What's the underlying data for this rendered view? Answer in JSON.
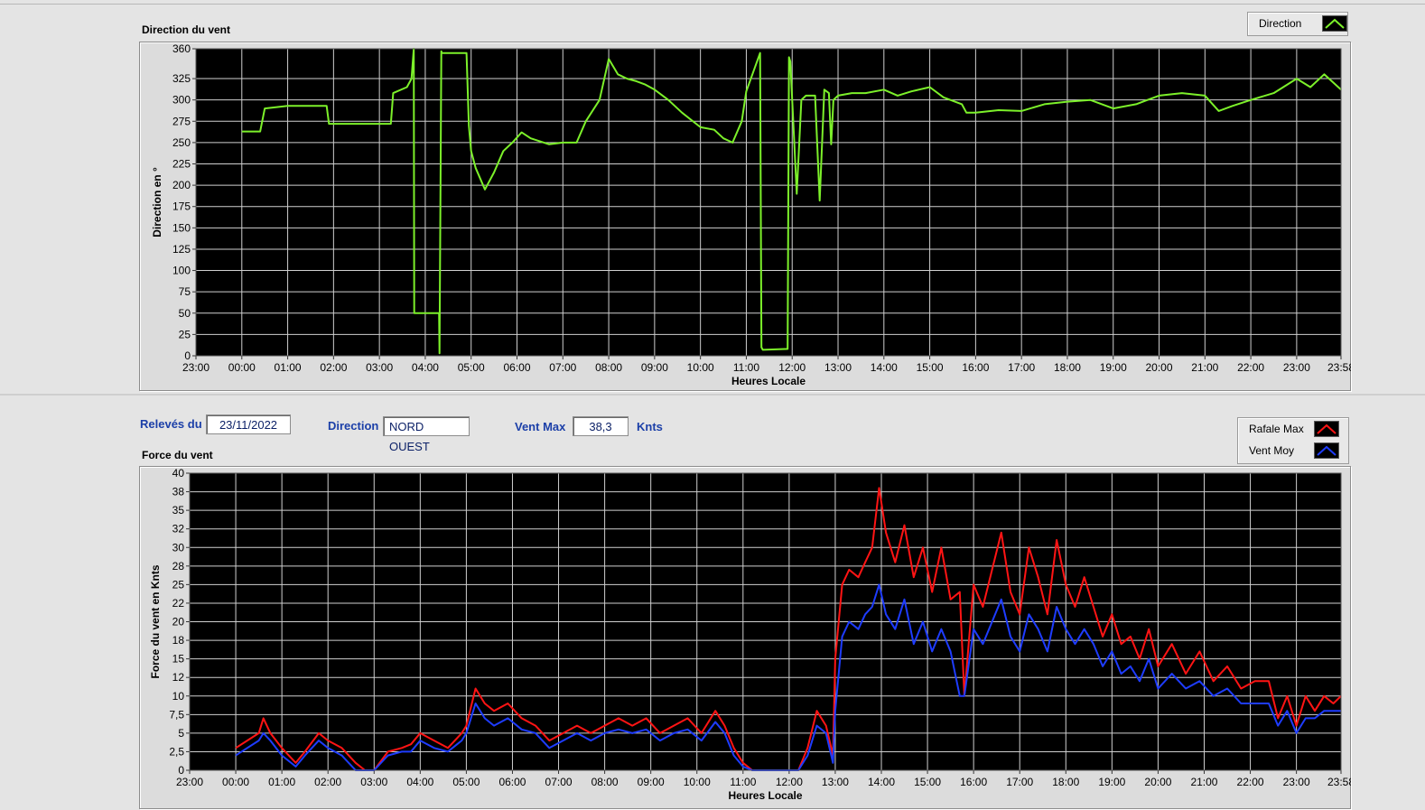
{
  "direction_panel": {
    "title": "Direction du vent"
  },
  "force_panel": {
    "title": "Force du vent"
  },
  "info": {
    "releves_label": "Relevés du",
    "releves_value": "23/11/2022",
    "direction_label": "Direction",
    "direction_value": "NORD OUEST",
    "ventmax_label": "Vent Max",
    "ventmax_value": "38,3",
    "ventmax_unit": "Knts"
  },
  "legend_direction": [
    {
      "label": "Direction",
      "color": "#7cf02a"
    }
  ],
  "legend_force": [
    {
      "label": "Rafale Max",
      "color": "#ff1414"
    },
    {
      "label": "Vent Moy",
      "color": "#1e3cff"
    }
  ],
  "colors": {
    "plot_bg": "#000000",
    "grid": "#cfcfcf",
    "direction": "#7cf02a",
    "rafale": "#ff1414",
    "ventmoy": "#1e3cff"
  },
  "chart_data": [
    {
      "type": "line",
      "xlabel": "Heures Locale",
      "ylabel": "Direction en °",
      "x_tick_labels": [
        "23:00",
        "00:00",
        "01:00",
        "02:00",
        "03:00",
        "04:00",
        "05:00",
        "06:00",
        "07:00",
        "08:00",
        "09:00",
        "10:00",
        "11:00",
        "12:00",
        "13:00",
        "14:00",
        "15:00",
        "16:00",
        "17:00",
        "18:00",
        "19:00",
        "20:00",
        "21:00",
        "22:00",
        "23:00",
        "23:58"
      ],
      "y_tick_labels": [
        "0",
        "25",
        "50",
        "75",
        "100",
        "125",
        "150",
        "175",
        "200",
        "225",
        "250",
        "275",
        "300",
        "325",
        "360"
      ],
      "y_ticks": [
        0,
        25,
        50,
        75,
        100,
        125,
        150,
        175,
        200,
        225,
        250,
        275,
        300,
        325,
        360
      ],
      "ylim": [
        0,
        360
      ],
      "xlim_hours": [
        -1,
        23.967
      ],
      "grid": true,
      "series": [
        {
          "name": "Direction",
          "x_hours": [
            0.0,
            0.4,
            0.5,
            1.0,
            1.6,
            1.85,
            1.9,
            2.5,
            3.0,
            3.25,
            3.3,
            3.6,
            3.7,
            3.75,
            3.76,
            4.0,
            4.3,
            4.31,
            4.35,
            4.36,
            4.5,
            4.9,
            4.95,
            5.0,
            5.1,
            5.3,
            5.5,
            5.7,
            5.9,
            6.1,
            6.3,
            6.7,
            7.0,
            7.3,
            7.5,
            7.8,
            8.0,
            8.2,
            8.4,
            8.6,
            8.8,
            9.0,
            9.3,
            9.6,
            10.0,
            10.3,
            10.5,
            10.7,
            10.9,
            11.0,
            11.3,
            11.33,
            11.36,
            11.9,
            11.93,
            11.96,
            12.1,
            12.2,
            12.3,
            12.5,
            12.6,
            12.7,
            12.8,
            12.85,
            12.9,
            13.0,
            13.3,
            13.6,
            14.0,
            14.3,
            14.6,
            15.0,
            15.3,
            15.7,
            15.8,
            16.0,
            16.5,
            17.0,
            17.5,
            18.0,
            18.5,
            19.0,
            19.5,
            20.0,
            20.5,
            21.0,
            21.3,
            21.6,
            22.0,
            22.5,
            23.0,
            23.3,
            23.6,
            23.967
          ],
          "values": [
            263,
            263,
            290,
            293,
            293,
            293,
            272,
            272,
            272,
            272,
            308,
            315,
            325,
            360,
            50,
            50,
            50,
            3,
            357,
            355,
            355,
            355,
            270,
            240,
            220,
            195,
            215,
            240,
            250,
            262,
            255,
            248,
            250,
            250,
            275,
            300,
            348,
            330,
            325,
            322,
            318,
            312,
            300,
            285,
            268,
            265,
            255,
            250,
            275,
            310,
            355,
            10,
            7,
            8,
            350,
            345,
            190,
            300,
            305,
            305,
            182,
            312,
            308,
            248,
            300,
            305,
            308,
            308,
            312,
            305,
            310,
            315,
            303,
            295,
            285,
            285,
            288,
            287,
            295,
            298,
            300,
            290,
            295,
            305,
            308,
            305,
            287,
            293,
            300,
            308,
            325,
            315,
            330,
            312
          ]
        }
      ]
    },
    {
      "type": "line",
      "xlabel": "Heures Locale",
      "ylabel": "Force du vent en Knts",
      "x_tick_labels": [
        "23:00",
        "00:00",
        "01:00",
        "02:00",
        "03:00",
        "04:00",
        "05:00",
        "06:00",
        "07:00",
        "08:00",
        "09:00",
        "10:00",
        "11:00",
        "12:00",
        "13:00",
        "14:00",
        "15:00",
        "16:00",
        "17:00",
        "18:00",
        "19:00",
        "20:00",
        "21:00",
        "22:00",
        "23:00",
        "23:58"
      ],
      "y_tick_labels": [
        "0",
        "2,5",
        "5",
        "7,5",
        "10",
        "12",
        "15",
        "18",
        "20",
        "22",
        "25",
        "28",
        "30",
        "32",
        "35",
        "38",
        "40"
      ],
      "y_ticks": [
        0,
        2.5,
        5,
        7.5,
        10,
        12.5,
        15,
        17.5,
        20,
        22.5,
        25,
        27.5,
        30,
        32.5,
        35,
        37.5,
        40
      ],
      "ylim": [
        0,
        40
      ],
      "xlim_hours": [
        -1,
        23.967
      ],
      "grid": true,
      "series": [
        {
          "name": "Rafale Max",
          "x_hours": [
            0.0,
            0.25,
            0.5,
            0.6,
            0.75,
            1.0,
            1.3,
            1.5,
            1.8,
            2.0,
            2.3,
            2.6,
            2.8,
            3.0,
            3.3,
            3.6,
            3.8,
            4.0,
            4.3,
            4.6,
            4.9,
            5.0,
            5.2,
            5.4,
            5.6,
            5.9,
            6.2,
            6.5,
            6.8,
            7.1,
            7.4,
            7.7,
            8.0,
            8.3,
            8.6,
            8.9,
            9.2,
            9.5,
            9.8,
            10.1,
            10.4,
            10.6,
            10.8,
            11.0,
            11.2,
            11.5,
            11.8,
            12.0,
            12.2,
            12.4,
            12.6,
            12.8,
            12.95,
            13.0,
            13.15,
            13.3,
            13.5,
            13.65,
            13.8,
            13.95,
            14.1,
            14.3,
            14.5,
            14.7,
            14.9,
            15.1,
            15.3,
            15.5,
            15.7,
            15.8,
            16.0,
            16.2,
            16.4,
            16.6,
            16.8,
            17.0,
            17.2,
            17.4,
            17.6,
            17.8,
            18.0,
            18.2,
            18.4,
            18.6,
            18.8,
            19.0,
            19.2,
            19.4,
            19.6,
            19.8,
            20.0,
            20.3,
            20.6,
            20.9,
            21.2,
            21.5,
            21.8,
            22.1,
            22.4,
            22.6,
            22.8,
            23.0,
            23.2,
            23.4,
            23.6,
            23.8,
            23.967
          ],
          "values": [
            3,
            4,
            5,
            7,
            5,
            3,
            1,
            2.5,
            5,
            4,
            3,
            1,
            0,
            0,
            2.5,
            3,
            3.5,
            5,
            4,
            3,
            5,
            6,
            11,
            9,
            8,
            9,
            7,
            6,
            4,
            5,
            6,
            5,
            6,
            7,
            6,
            7,
            5,
            6,
            7,
            5,
            8,
            6,
            3,
            1,
            0,
            0,
            0,
            0,
            0,
            3,
            8,
            6,
            2,
            15,
            25,
            27,
            26,
            28,
            30,
            38,
            32,
            28,
            33,
            26,
            30,
            24,
            30,
            23,
            24,
            10,
            25,
            22,
            27,
            32,
            24,
            21,
            30,
            26,
            21,
            31,
            25,
            22,
            26,
            22,
            18,
            21,
            17,
            18,
            15,
            19,
            14,
            17,
            13,
            16,
            12,
            14,
            11,
            12,
            12,
            7,
            10,
            6,
            10,
            8,
            10,
            9,
            10
          ]
        },
        {
          "name": "Vent Moy",
          "x_hours": [
            0.0,
            0.25,
            0.5,
            0.6,
            0.75,
            1.0,
            1.3,
            1.5,
            1.8,
            2.0,
            2.3,
            2.6,
            2.8,
            3.0,
            3.3,
            3.6,
            3.8,
            4.0,
            4.3,
            4.6,
            4.9,
            5.0,
            5.2,
            5.4,
            5.6,
            5.9,
            6.2,
            6.5,
            6.8,
            7.1,
            7.4,
            7.7,
            8.0,
            8.3,
            8.6,
            8.9,
            9.2,
            9.5,
            9.8,
            10.1,
            10.4,
            10.6,
            10.8,
            11.0,
            11.2,
            11.5,
            11.8,
            12.0,
            12.2,
            12.4,
            12.6,
            12.8,
            12.95,
            13.0,
            13.15,
            13.3,
            13.5,
            13.65,
            13.8,
            13.95,
            14.1,
            14.3,
            14.5,
            14.7,
            14.9,
            15.1,
            15.3,
            15.5,
            15.7,
            15.8,
            16.0,
            16.2,
            16.4,
            16.6,
            16.8,
            17.0,
            17.2,
            17.4,
            17.6,
            17.8,
            18.0,
            18.2,
            18.4,
            18.6,
            18.8,
            19.0,
            19.2,
            19.4,
            19.6,
            19.8,
            20.0,
            20.3,
            20.6,
            20.9,
            21.2,
            21.5,
            21.8,
            22.1,
            22.4,
            22.6,
            22.8,
            23.0,
            23.2,
            23.4,
            23.6,
            23.8,
            23.967
          ],
          "values": [
            2,
            3,
            4,
            5,
            4,
            2,
            0.5,
            2,
            4,
            3,
            2,
            0,
            0,
            0,
            2,
            2.5,
            2.5,
            4,
            3,
            2.5,
            4,
            5,
            9,
            7,
            6,
            7,
            5.5,
            5,
            3,
            4,
            5,
            4,
            5,
            5.5,
            5,
            5.5,
            4,
            5,
            5.5,
            4,
            6.5,
            5,
            2,
            0.5,
            0,
            0,
            0,
            0,
            0,
            2,
            6,
            5,
            1,
            8,
            18,
            20,
            19,
            21,
            22,
            25,
            21,
            19,
            23,
            17,
            20,
            16,
            19,
            16,
            10,
            10,
            19,
            17,
            20,
            23,
            18,
            16,
            21,
            19,
            16,
            22,
            19,
            17,
            19,
            17,
            14,
            16,
            13,
            14,
            12,
            15,
            11,
            13,
            11,
            12,
            10,
            11,
            9,
            9,
            9,
            6,
            8,
            5,
            7,
            7,
            8,
            8,
            8
          ]
        }
      ]
    }
  ]
}
